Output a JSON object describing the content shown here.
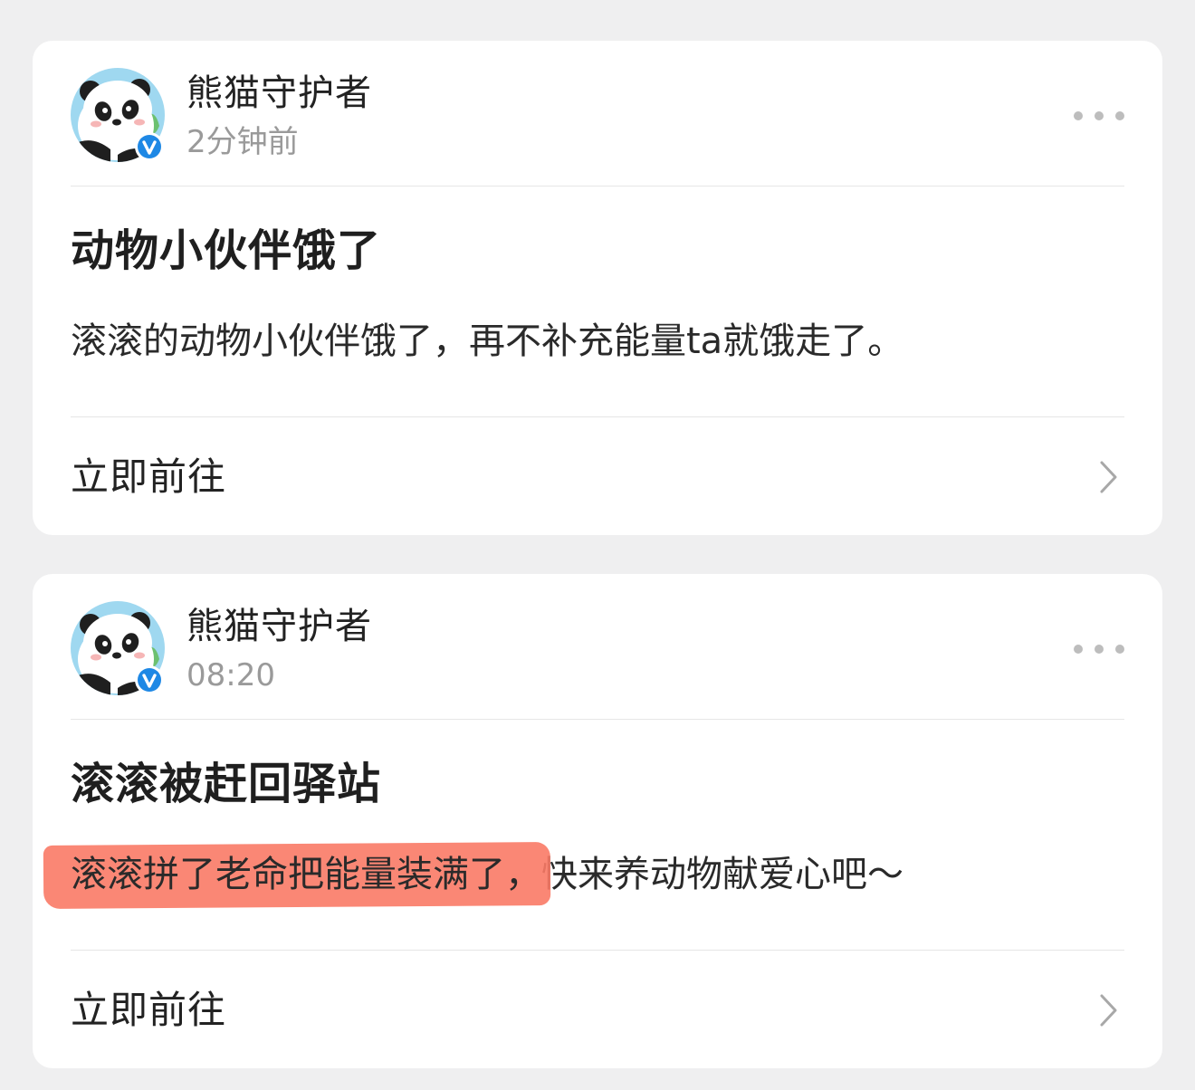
{
  "colors": {
    "background": "#efeff0",
    "card": "#ffffff",
    "highlight": "#f97a66",
    "verified_badge": "#1e88e5",
    "meta_text": "#9a9a9a"
  },
  "notifications": [
    {
      "author": "熊猫守护者",
      "time": "2分钟前",
      "title": "动物小伙伴饿了",
      "body_highlight": "",
      "body": "滚滚的动物小伙伴饿了，再不补充能量ta就饿走了。",
      "action_label": "立即前往",
      "avatar_icon": "panda-avatar",
      "badge_icon": "verified-v-icon",
      "more_icon": "more-dots-icon",
      "chevron_icon": "chevron-right-icon"
    },
    {
      "author": "熊猫守护者",
      "time": "08:20",
      "title": "滚滚被赶回驿站",
      "body_highlight": "滚滚拼了老命把能量装满了，",
      "body": "快来养动物献爱心吧～",
      "action_label": "立即前往",
      "avatar_icon": "panda-avatar",
      "badge_icon": "verified-v-icon",
      "more_icon": "more-dots-icon",
      "chevron_icon": "chevron-right-icon"
    }
  ]
}
